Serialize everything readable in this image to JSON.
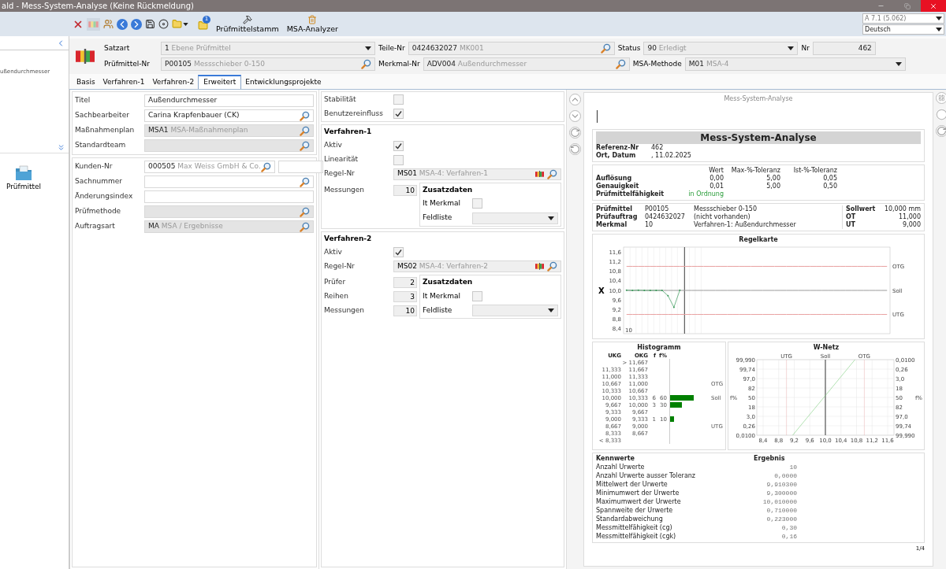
{
  "window": {
    "title": "ald - Mess-System-Analyse (Keine Rückmeldung)"
  },
  "toolbar": {
    "badge": "1",
    "buttons": [
      {
        "label": "Prüfmittelstamm",
        "kind": "tools"
      },
      {
        "label": "MSA-Analyzer",
        "kind": "analyzer"
      }
    ],
    "version": "A 7.1 (5.062)",
    "language": "Deutsch"
  },
  "sidebar": {
    "text": "ußendurchmesser",
    "items": [
      {
        "label": "Prüfmittel"
      }
    ]
  },
  "header": {
    "row1": [
      {
        "label": "Satzart",
        "code": "1",
        "value": "Ebene Prüfmittel",
        "kind": "dropdown"
      },
      {
        "label": "Teile-Nr",
        "code": "0424632027",
        "value": "MK001",
        "kind": "lookup"
      },
      {
        "label": "Status",
        "code": "90",
        "value": "Erledigt",
        "kind": "dropdown"
      },
      {
        "label": "Nr",
        "value": "462",
        "kind": "number"
      }
    ],
    "row2": [
      {
        "label": "Prüfmittel-Nr",
        "code": "P00105",
        "value": "Messschieber 0-150",
        "kind": "lookup"
      },
      {
        "label": "Merkmal-Nr",
        "code": "ADV004",
        "value": "Außendurchmesser",
        "kind": "lookup"
      },
      {
        "label": "MSA-Methode",
        "code": "M01",
        "value": "MSA-4",
        "kind": "dropdown"
      }
    ]
  },
  "tabs": [
    {
      "label": "Basis",
      "selected": false
    },
    {
      "label": "Verfahren-1",
      "selected": false
    },
    {
      "label": "Verfahren-2",
      "selected": false
    },
    {
      "label": "Erweitert",
      "selected": true
    },
    {
      "label": "Entwicklungsprojekte",
      "selected": false
    }
  ],
  "general": {
    "fields": [
      {
        "label": "Titel",
        "value": "Außendurchmesser",
        "kind": "text",
        "readonly": false
      },
      {
        "label": "Sachbearbeiter",
        "value": "Carina Krapfenbauer (CK)",
        "kind": "lookup",
        "readonly": false
      },
      {
        "label": "Maßnahmenplan",
        "code": "MSA1",
        "value": "MSA-Maßnahmenplan",
        "kind": "lookup",
        "readonly": true
      },
      {
        "label": "Standardteam",
        "kind": "lookup",
        "readonly": true
      }
    ]
  },
  "customer": {
    "fields": [
      {
        "label": "Kunden-Nr",
        "code": "000505",
        "value": "Max Weiss GmbH & Co.",
        "kind": "lookup-extra",
        "readonly": false
      },
      {
        "label": "Sachnummer",
        "kind": "lookup",
        "readonly": false
      },
      {
        "label": "Änderungsindex",
        "kind": "text",
        "readonly": false
      },
      {
        "label": "Prüfmethode",
        "kind": "lookup",
        "readonly": true
      },
      {
        "label": "Auftragsart",
        "code": "MA",
        "value": "MSA / Ergebnisse",
        "kind": "lookup",
        "readonly": true
      }
    ]
  },
  "options": {
    "checks": [
      {
        "label": "Stabilität",
        "checked": false
      },
      {
        "label": "Benutzereinfluss",
        "checked": true
      }
    ]
  },
  "procedures": [
    {
      "title": "Verfahren-1",
      "rows": [
        {
          "kind": "check",
          "label": "Aktiv",
          "checked": true
        },
        {
          "kind": "check",
          "label": "Linearität",
          "checked": false
        },
        {
          "kind": "rule",
          "label": "Regel-Nr",
          "code": "MS01",
          "value": "MSA-4: Verfahren-1"
        }
      ],
      "numbers": [
        {
          "label": "Messungen",
          "value": "10"
        }
      ],
      "extra": {
        "title": "Zusatzdaten",
        "checks": [
          {
            "label": "It Merkmal",
            "checked": false
          }
        ],
        "dropdown": "Feldliste"
      }
    },
    {
      "title": "Verfahren-2",
      "rows": [
        {
          "kind": "check",
          "label": "Aktiv",
          "checked": true
        },
        {
          "kind": "rule",
          "label": "Regel-Nr",
          "code": "MS02",
          "value": "MSA-4: Verfahren-2"
        }
      ],
      "numbers": [
        {
          "label": "Prüfer",
          "value": "2"
        },
        {
          "label": "Reihen",
          "value": "3"
        },
        {
          "label": "Messungen",
          "value": "10"
        }
      ],
      "extra": {
        "title": "Zusatzdaten",
        "checks": [
          {
            "label": "It Merkmal",
            "checked": false
          }
        ],
        "dropdown": "Feldliste"
      }
    }
  ],
  "preview": {
    "title": "Mess-System-Analyse",
    "page": "1/4",
    "report": {
      "title": "Mess-System-Analyse",
      "reference": [
        {
          "label": "Referenz-Nr",
          "value": "462"
        },
        {
          "label": "Ort, Datum",
          "value": ", 11.02.2025"
        }
      ],
      "tolerance": {
        "columns": [
          "Wert",
          "Max-%-Toleranz",
          "Ist-%-Toleranz"
        ],
        "rows": [
          {
            "label": "Auflösung",
            "values": [
              "0,00",
              "5,00",
              "0,05"
            ]
          },
          {
            "label": "Genauigkeit",
            "values": [
              "0,01",
              "5,00",
              "0,50"
            ]
          }
        ],
        "result": {
          "label": "Prüfmittelfähigkeit",
          "value": "in Ordnung",
          "ok": true
        }
      },
      "info": [
        {
          "label": "Prüfmittel",
          "value": "P00105",
          "note": "Messschieber 0-150"
        },
        {
          "label": "Prüfauftrag",
          "value": "0424632027",
          "note": "(nicht vorhanden)"
        },
        {
          "label": "Merkmal",
          "value": "10",
          "note": "Verfahren-1: Außendurchmesser"
        }
      ],
      "limits": [
        {
          "label": "Sollwert",
          "value": "10,000 mm"
        },
        {
          "label": "OT",
          "value": "11,000"
        },
        {
          "label": "UT",
          "value": "9,000"
        }
      ],
      "control_chart": {
        "title": "Regelkarte",
        "chart_data": {
          "type": "line",
          "categories": [
            null,
            null,
            null,
            null,
            null,
            null,
            null,
            null,
            null,
            null,
            null,
            null,
            null,
            null,
            null,
            null,
            null,
            null,
            null,
            null,
            null,
            null,
            null,
            null,
            null,
            null,
            null,
            null,
            null,
            null,
            null,
            null,
            null,
            null,
            null,
            null,
            null,
            null,
            null,
            null,
            null,
            null,
            null,
            null,
            null
          ],
          "ylim": [
            8.2,
            11.8
          ],
          "yticks": [
            {
              "value": 11.6,
              "label": "11,6"
            },
            {
              "value": 11.2,
              "label": "11,2"
            },
            {
              "value": 10.8,
              "label": "10,8"
            },
            {
              "value": 10.4,
              "label": "10,4"
            },
            {
              "value": 10.0,
              "label": "10,0"
            },
            {
              "value": 9.6,
              "label": "9,6"
            },
            {
              "value": 9.2,
              "label": "9,2"
            },
            {
              "value": 8.8,
              "label": "8,8"
            },
            {
              "value": 8.4,
              "label": "8,4"
            }
          ],
          "series": [
            {
              "name": "X",
              "color": "#3a9a5a",
              "values": [
                10.01,
                10.0,
                10.01,
                10.0,
                10.0,
                10.0,
                10.0,
                9.78,
                9.3,
                10.01,
                null,
                null,
                null,
                null,
                null,
                null,
                null,
                null,
                null,
                null,
                null,
                null,
                null,
                null,
                null,
                null,
                null,
                null,
                null,
                null,
                null,
                null,
                null,
                null,
                null,
                null,
                null,
                null,
                null,
                null,
                null,
                null,
                null,
                null,
                null
              ]
            },
            {
              "name": "OTG",
              "color": "#e8a0a0",
              "values": [
                11.0,
                11.0,
                11.0,
                11.0,
                11.0,
                11.0,
                11.0,
                11.0,
                11.0,
                11.0,
                11.0,
                11.0,
                11.0,
                11.0,
                11.0,
                11.0,
                11.0,
                11.0,
                11.0,
                11.0,
                11.0,
                11.0,
                11.0,
                11.0,
                11.0,
                11.0,
                11.0,
                11.0,
                11.0,
                11.0,
                11.0,
                11.0,
                11.0,
                11.0,
                11.0,
                11.0,
                11.0,
                11.0,
                11.0,
                11.0,
                11.0,
                11.0,
                11.0,
                11.0,
                11.0
              ]
            },
            {
              "name": "Soll",
              "color": "#9a9a9a",
              "values": [
                10.0,
                10.0,
                10.0,
                10.0,
                10.0,
                10.0,
                10.0,
                10.0,
                10.0,
                10.0,
                10.0,
                10.0,
                10.0,
                10.0,
                10.0,
                10.0,
                10.0,
                10.0,
                10.0,
                10.0,
                10.0,
                10.0,
                10.0,
                10.0,
                10.0,
                10.0,
                10.0,
                10.0,
                10.0,
                10.0,
                10.0,
                10.0,
                10.0,
                10.0,
                10.0,
                10.0,
                10.0,
                10.0,
                10.0,
                10.0,
                10.0,
                10.0,
                10.0,
                10.0,
                10.0
              ]
            },
            {
              "name": "UTG",
              "color": "#e8a0a0",
              "values": [
                9.0,
                9.0,
                9.0,
                9.0,
                9.0,
                9.0,
                9.0,
                9.0,
                9.0,
                9.0,
                9.0,
                9.0,
                9.0,
                9.0,
                9.0,
                9.0,
                9.0,
                9.0,
                9.0,
                9.0,
                9.0,
                9.0,
                9.0,
                9.0,
                9.0,
                9.0,
                9.0,
                9.0,
                9.0,
                9.0,
                9.0,
                9.0,
                9.0,
                9.0,
                9.0,
                9.0,
                9.0,
                9.0,
                9.0,
                9.0,
                9.0,
                9.0,
                9.0,
                9.0,
                9.0
              ]
            }
          ],
          "annotations": [
            "10"
          ]
        }
      },
      "histogram": {
        "title": "Histogramm",
        "columns": [
          "UKG",
          "OKG",
          "f",
          "f%"
        ],
        "rows": [
          {
            "okg": "> 11,667"
          },
          {
            "ukg": "11,333",
            "okg": "11,667"
          },
          {
            "ukg": "11,000",
            "okg": "11,333"
          },
          {
            "ukg": "10,667",
            "okg": "11,000",
            "limit": "OTG"
          },
          {
            "ukg": "10,333",
            "okg": "10,667"
          },
          {
            "ukg": "10,000",
            "okg": "10,333",
            "f": "6",
            "pct": "60",
            "level": 0.6,
            "limit": "Soll"
          },
          {
            "ukg": "9,667",
            "okg": "10,000",
            "f": "3",
            "pct": "30",
            "level": 0.3
          },
          {
            "ukg": "9,333",
            "okg": "9,667"
          },
          {
            "ukg": "9,000",
            "okg": "9,333",
            "f": "1",
            "pct": "10",
            "level": 0.1
          },
          {
            "ukg": "8,667",
            "okg": "9,000",
            "limit": "UTG"
          },
          {
            "ukg": "8,333",
            "okg": "8,667"
          },
          {
            "ukg": "< 8,333"
          }
        ]
      },
      "probability_plot": {
        "title": "W-Netz",
        "top_labels": [
          "UTG",
          "Soll",
          "OTG"
        ],
        "left_labels": [
          "99,990",
          "99,74",
          "97,0",
          "82",
          "50",
          "18",
          "3,0",
          "0,26",
          "0,0100"
        ],
        "right_labels": [
          "0,0100",
          "0,26",
          "3,0",
          "18",
          "50",
          "82",
          "97,0",
          "99,74",
          "99,990"
        ],
        "bottom_labels": [
          "8,4",
          "8,8",
          "9,2",
          "9,6",
          "10,0",
          "10,4",
          "10,8",
          "11,2",
          "11,6"
        ],
        "axis_labels": [
          "f%",
          "f%"
        ]
      },
      "statistics": {
        "columns": [
          "Kennwerte",
          "Ergebnis"
        ],
        "rows": [
          {
            "label": "Anzahl Urwerte",
            "value": "10"
          },
          {
            "label": "Anzahl Urwerte ausser Toleranz",
            "value": "0,0000"
          },
          {
            "label": "Mittelwert der Urwerte",
            "value": "9,910300"
          },
          {
            "label": "Minimumwert der Urwerte",
            "value": "9,300000"
          },
          {
            "label": "Maximumwert der Urwerte",
            "value": "10,010000"
          },
          {
            "label": "Spannweite der Urwerte",
            "value": "0,710000"
          },
          {
            "label": "Standardabweichung",
            "value": "0,223000"
          },
          {
            "label": "Messmittelfähigkeit (cg)",
            "value": "0,30"
          },
          {
            "label": "Messmittelfähigkeit (cgk)",
            "value": "0,16"
          }
        ]
      }
    }
  }
}
